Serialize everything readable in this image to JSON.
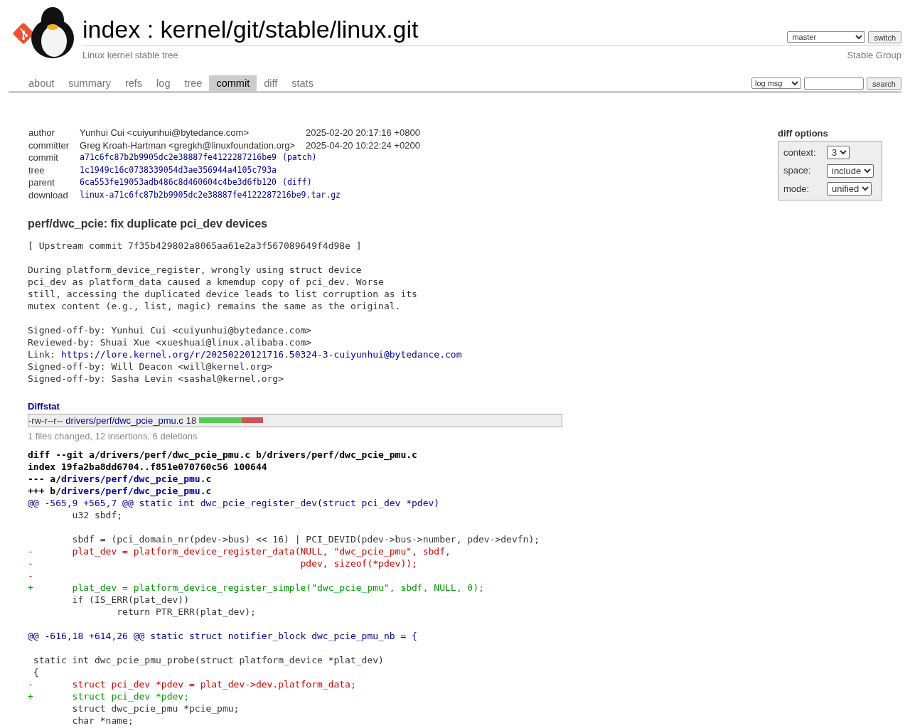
{
  "header": {
    "title": "index : kernel/git/stable/linux.git",
    "description": "Linux kernel stable tree",
    "branch": "master",
    "switch_button": "switch",
    "owner": "Stable Group"
  },
  "tabs": [
    {
      "label": "about",
      "selected": false
    },
    {
      "label": "summary",
      "selected": false
    },
    {
      "label": "refs",
      "selected": false
    },
    {
      "label": "log",
      "selected": false
    },
    {
      "label": "tree",
      "selected": false
    },
    {
      "label": "commit",
      "selected": true
    },
    {
      "label": "diff",
      "selected": false
    },
    {
      "label": "stats",
      "selected": false
    }
  ],
  "search": {
    "scope": "log msg",
    "button": "search"
  },
  "commit_info": [
    {
      "kind": "person",
      "label": "author",
      "value": "Yunhui Cui <cuiyunhui@bytedance.com>",
      "date": "2025-02-20 20:17:16 +0800"
    },
    {
      "kind": "person",
      "label": "committer",
      "value": "Greg Kroah-Hartman <gregkh@linuxfoundation.org>",
      "date": "2025-04-20 10:22:24 +0200"
    },
    {
      "kind": "hash",
      "label": "commit",
      "value": "a71c6fc87b2b9905dc2e38887fe4122287216be9",
      "extra": "(patch)"
    },
    {
      "kind": "hash",
      "label": "tree",
      "value": "1c1949c16c0738339054d3ae356944a4105c793a"
    },
    {
      "kind": "hash",
      "label": "parent",
      "value": "6ca553fe19053adb486c8d460604c4be3d6fb120",
      "extra": "(diff)"
    },
    {
      "kind": "hash",
      "label": "download",
      "value": "linux-a71c6fc87b2b9905dc2e38887fe4122287216be9.tar.gz"
    }
  ],
  "diff_options": {
    "title": "diff options",
    "rows": [
      {
        "label": "context:",
        "value": "3"
      },
      {
        "label": "space:",
        "value": "include"
      },
      {
        "label": "mode:",
        "value": "unified"
      }
    ]
  },
  "subject": "perf/dwc_pcie: fix duplicate pci_dev devices",
  "message": [
    [
      {
        "kind": "text",
        "text": "[ Upstream commit 7f35b429802a8065aa61e2a3f567089649f4d98e ]"
      }
    ],
    [
      {
        "kind": "text",
        "text": "During platform_device_register, wrongly using struct device\npci_dev as platform_data caused a kmemdup copy of pci_dev. Worse\nstill, accessing the duplicated device leads to list corruption as its\nmutex content (e.g., list, magic) remains the same as the original."
      }
    ],
    [
      {
        "kind": "text",
        "text": "Signed-off-by: Yunhui Cui <cuiyunhui@bytedance.com>"
      },
      {
        "kind": "text",
        "text": "Reviewed-by: Shuai Xue <xueshuai@linux.alibaba.com>"
      },
      {
        "kind": "link",
        "label": "Link: ",
        "url": "https://lore.kernel.org/r/20250220121716.50324-3-cuiyunhui@bytedance.com"
      },
      {
        "kind": "text",
        "text": "Signed-off-by: Will Deacon <will@kernel.org>"
      },
      {
        "kind": "text",
        "text": "Signed-off-by: Sasha Levin <sashal@kernel.org>"
      }
    ]
  ],
  "diffstat": {
    "title": "Diffstat",
    "rows": [
      {
        "mode": "-rw-r--r--",
        "file": "drivers/perf/dwc_pcie_pmu.c",
        "count": "18",
        "level": 0.667
      }
    ],
    "summary": "1 files changed, 12 insertions, 6 deletions"
  },
  "diff": [
    {
      "kind": "head",
      "text": "diff --git a/drivers/perf/dwc_pcie_pmu.c b/drivers/perf/dwc_pcie_pmu.c"
    },
    {
      "kind": "head",
      "text": "index 19fa2ba8dd6704..f851e070760c56 100644"
    },
    {
      "kind": "file",
      "prefix": "--- a/",
      "path": "drivers/perf/dwc_pcie_pmu.c"
    },
    {
      "kind": "file",
      "prefix": "+++ b/",
      "path": "drivers/perf/dwc_pcie_pmu.c"
    },
    {
      "kind": "hunk",
      "text": "@@ -565,9 +565,7 @@ static int dwc_pcie_register_dev(struct pci_dev *pdev)"
    },
    {
      "kind": "ctx",
      "text": "        u32 sbdf;"
    },
    {
      "kind": "blank"
    },
    {
      "kind": "ctx",
      "text": "        sbdf = (pci_domain_nr(pdev->bus) << 16) | PCI_DEVID(pdev->bus->number, pdev->devfn);"
    },
    {
      "kind": "del",
      "text": "-       plat_dev = platform_device_register_data(NULL, \"dwc_pcie_pmu\", sbdf,"
    },
    {
      "kind": "del",
      "text": "-                                                pdev, sizeof(*pdev));"
    },
    {
      "kind": "del",
      "text": "-"
    },
    {
      "kind": "add",
      "text": "+       plat_dev = platform_device_register_simple(\"dwc_pcie_pmu\", sbdf, NULL, 0);"
    },
    {
      "kind": "ctx",
      "text": "        if (IS_ERR(plat_dev))"
    },
    {
      "kind": "ctx",
      "text": "                return PTR_ERR(plat_dev);"
    },
    {
      "kind": "blank"
    },
    {
      "kind": "hunk",
      "text": "@@ -616,18 +614,26 @@ static struct notifier_block dwc_pcie_pmu_nb = {"
    },
    {
      "kind": "blank"
    },
    {
      "kind": "ctx",
      "text": " static int dwc_pcie_pmu_probe(struct platform_device *plat_dev)"
    },
    {
      "kind": "ctx",
      "text": " {"
    },
    {
      "kind": "del",
      "text": "-       struct pci_dev *pdev = plat_dev->dev.platform_data;"
    },
    {
      "kind": "add",
      "text": "+       struct pci_dev *pdev;"
    },
    {
      "kind": "ctx",
      "text": "        struct dwc_pcie_pmu *pcie_pmu;"
    },
    {
      "kind": "ctx",
      "text": "        char *name;"
    }
  ]
}
